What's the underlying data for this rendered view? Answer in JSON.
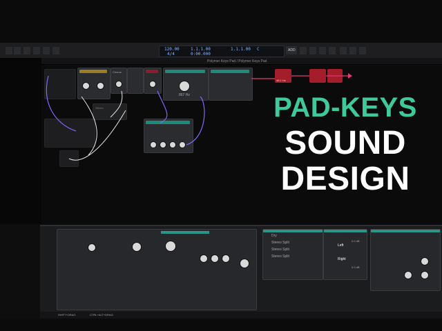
{
  "headline": {
    "line1": "PAD-KEYS",
    "line2": "SOUND",
    "line3": "DESIGN",
    "accent_color": "#3fc99b",
    "text_color": "#ffffff"
  },
  "window": {
    "title": "Polymer Keys Pad / Polymer Keys Pad"
  },
  "transport": {
    "tempo": "120.00",
    "signature": "4/4",
    "position": "1.1.1.00",
    "time": "0:00.000",
    "loop_position": "1.1.1.00",
    "key": "C",
    "label_add": "ADD"
  },
  "rack": {
    "filter_freq": "867 Hz",
    "filter_freq_2": "46.1 Hz",
    "chorus": "Chorus",
    "gain": "Gain",
    "mix": "Mix",
    "stereo": "Stereo"
  },
  "mixer": {
    "slots": [
      "Dry",
      "Stereo Split",
      "Stereo Split",
      "Stereo Split"
    ],
    "left": "Left",
    "right": "Right",
    "db1": "0.0 dB",
    "db2": "0.0 dB",
    "mid_label": "Mid"
  },
  "status": {
    "left": "SHIFT+DRAG",
    "middle": "CTRL+ALT+DRAG"
  },
  "colors": {
    "module_red": "#a31d2b",
    "module_teal": "#1d8a7a",
    "cable_purple": "#7b6cff",
    "cable_white": "#e8e8e8",
    "cable_pink": "#e23a72"
  }
}
